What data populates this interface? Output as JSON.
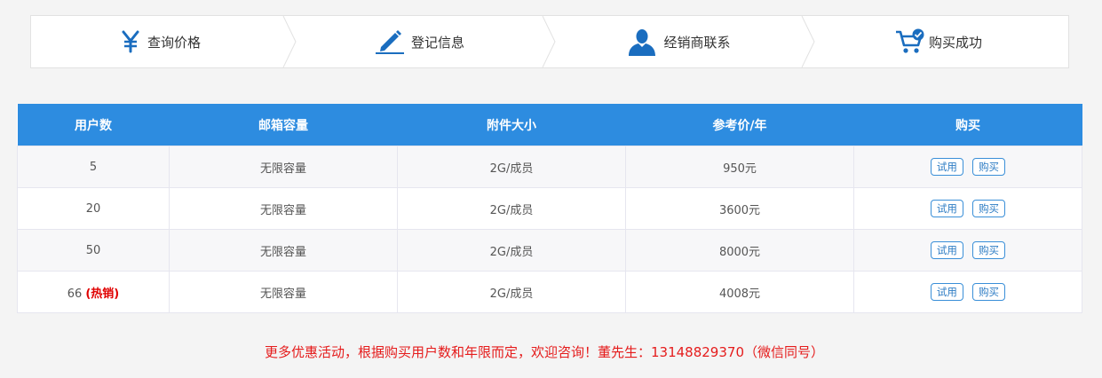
{
  "steps": [
    {
      "label": "查询价格",
      "icon": "yen-icon"
    },
    {
      "label": "登记信息",
      "icon": "pen-icon"
    },
    {
      "label": "经销商联系",
      "icon": "person-icon"
    },
    {
      "label": "购买成功",
      "icon": "cart-check-icon"
    }
  ],
  "colors": {
    "accent": "#2d8ce0",
    "icon": "#1a6dbf",
    "note": "#e51c1c"
  },
  "table": {
    "headers": [
      "用户数",
      "邮箱容量",
      "附件大小",
      "参考价/年",
      "购买"
    ],
    "rows": [
      {
        "users": "5",
        "hot": "",
        "capacity": "无限容量",
        "attachment": "2G/成员",
        "price": "950元",
        "trial": "试用",
        "buy": "购买"
      },
      {
        "users": "20",
        "hot": "",
        "capacity": "无限容量",
        "attachment": "2G/成员",
        "price": "3600元",
        "trial": "试用",
        "buy": "购买"
      },
      {
        "users": "50",
        "hot": "",
        "capacity": "无限容量",
        "attachment": "2G/成员",
        "price": "8000元",
        "trial": "试用",
        "buy": "购买"
      },
      {
        "users": "66",
        "hot": "(热销)",
        "capacity": "无限容量",
        "attachment": "2G/成员",
        "price": "4008元",
        "trial": "试用",
        "buy": "购买"
      }
    ]
  },
  "note": "更多优惠活动，根据购买用户数和年限而定，欢迎咨询！董先生：13148829370（微信同号）"
}
